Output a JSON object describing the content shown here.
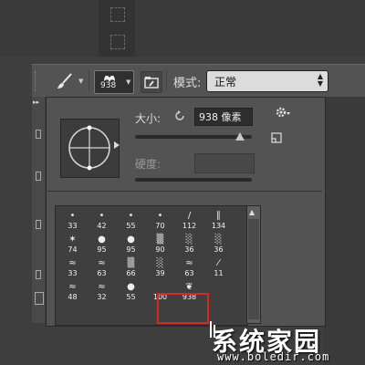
{
  "options_bar": {
    "brush_size_value": "938",
    "mode_label": "模式:",
    "mode_value": "正常"
  },
  "brush_panel": {
    "size_label": "大小:",
    "size_value": "938 像素",
    "size_slider_fraction": 0.9,
    "hardness_label": "硬度:",
    "hardness_value": ""
  },
  "presets": [
    {
      "glyph": "•",
      "size": "33"
    },
    {
      "glyph": "•",
      "size": "42"
    },
    {
      "glyph": "•",
      "size": "55"
    },
    {
      "glyph": "•",
      "size": "70"
    },
    {
      "glyph": "/",
      "size": "112"
    },
    {
      "glyph": "∥",
      "size": "134"
    },
    {
      "glyph": "✶",
      "size": "74"
    },
    {
      "glyph": "●",
      "size": "95"
    },
    {
      "glyph": "●",
      "size": "95"
    },
    {
      "glyph": "▒",
      "size": "90"
    },
    {
      "glyph": "░",
      "size": "36"
    },
    {
      "glyph": "░",
      "size": "36"
    },
    {
      "glyph": "≈",
      "size": "33"
    },
    {
      "glyph": "≈",
      "size": "63"
    },
    {
      "glyph": "▒",
      "size": "66"
    },
    {
      "glyph": "░",
      "size": "39"
    },
    {
      "glyph": "≈",
      "size": "63"
    },
    {
      "glyph": "⁄",
      "size": "11"
    },
    {
      "glyph": "≈",
      "size": "48"
    },
    {
      "glyph": "≈",
      "size": "32"
    },
    {
      "glyph": "●",
      "size": "55"
    },
    {
      "glyph": "",
      "size": "100"
    },
    {
      "glyph": "❦",
      "size": "938"
    }
  ],
  "selected_preset_index": 22,
  "watermark": {
    "title": "系统家园",
    "url": "www.boledir.com"
  },
  "colors": {
    "panel_bg": "#535353",
    "highlight": "#d8271d"
  }
}
